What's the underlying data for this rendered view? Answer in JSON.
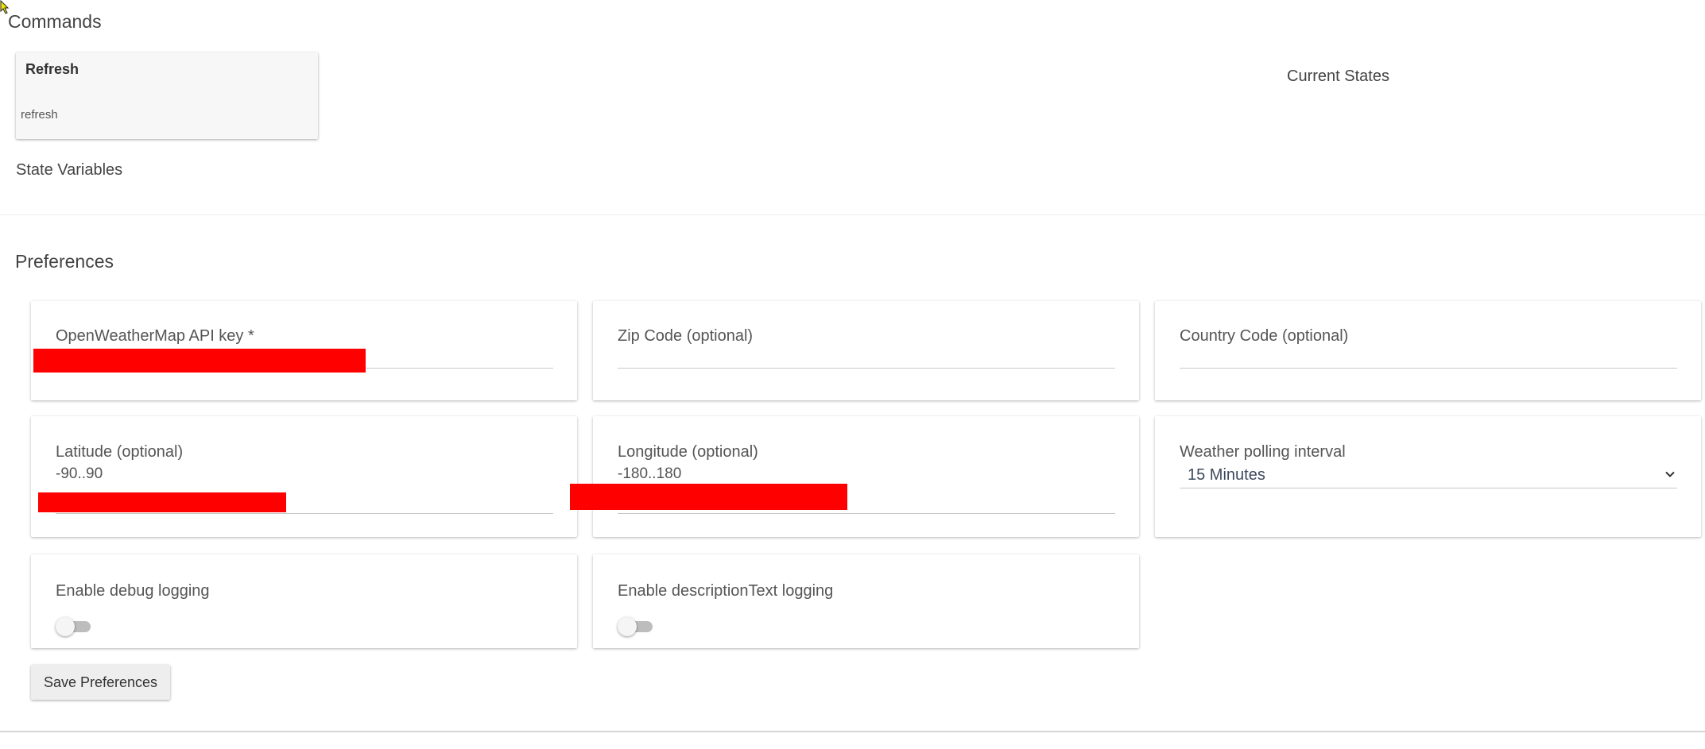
{
  "commands": {
    "title": "Commands",
    "items": [
      {
        "name": "Refresh",
        "method": "refresh"
      }
    ]
  },
  "current_states": {
    "title": "Current States"
  },
  "state_variables": {
    "title": "State Variables"
  },
  "preferences": {
    "title": "Preferences",
    "api_key": {
      "label": "OpenWeatherMap API key *",
      "value": ""
    },
    "zip_code": {
      "label": "Zip Code (optional)",
      "value": ""
    },
    "country_code": {
      "label": "Country Code (optional)",
      "value": ""
    },
    "latitude": {
      "label": "Latitude (optional)",
      "hint": "-90..90",
      "value": ""
    },
    "longitude": {
      "label": "Longitude (optional)",
      "hint": "-180..180",
      "value": ""
    },
    "polling_interval": {
      "label": "Weather polling interval",
      "selected": "15 Minutes"
    },
    "debug_logging": {
      "label": "Enable debug logging",
      "enabled": false
    },
    "description_logging": {
      "label": "Enable descriptionText logging",
      "enabled": false
    },
    "save_label": "Save Preferences"
  },
  "colors": {
    "redaction": "#ff0000",
    "toggle_track_off": "#bdbdbd"
  },
  "icons": {
    "cursor": "mouse-pointer-icon",
    "select": "chevron-down-icon"
  }
}
